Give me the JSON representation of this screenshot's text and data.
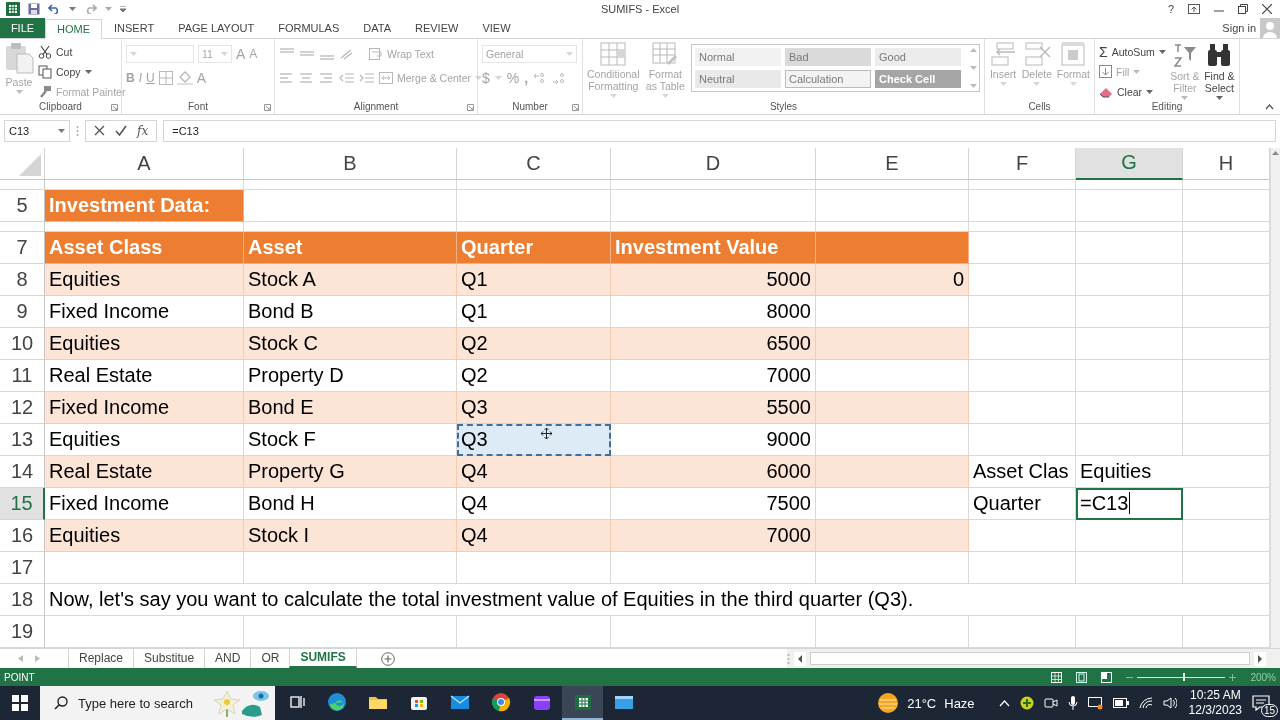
{
  "window": {
    "title": "SUMIFS - Excel",
    "help": "?"
  },
  "ribbon_tabs": [
    {
      "label": "FILE",
      "kind": "file",
      "selected": false
    },
    {
      "label": "HOME",
      "kind": "tab",
      "selected": true
    },
    {
      "label": "INSERT",
      "kind": "tab",
      "selected": false
    },
    {
      "label": "PAGE LAYOUT",
      "kind": "tab",
      "selected": false
    },
    {
      "label": "FORMULAS",
      "kind": "tab",
      "selected": false
    },
    {
      "label": "DATA",
      "kind": "tab",
      "selected": false
    },
    {
      "label": "REVIEW",
      "kind": "tab",
      "selected": false
    },
    {
      "label": "VIEW",
      "kind": "tab",
      "selected": false
    }
  ],
  "account": {
    "label": "Sign in"
  },
  "ribbon": {
    "clipboard": {
      "label": "Clipboard",
      "paste": {
        "label": "Paste",
        "disabled": true
      },
      "cut": {
        "label": "Cut",
        "disabled": false
      },
      "copy": {
        "label": "Copy",
        "disabled": false
      },
      "format_painter": {
        "label": "Format Painter",
        "disabled": true
      }
    },
    "font": {
      "label": "Font",
      "disabled": true,
      "size": "11",
      "grow": "A",
      "shrink": "A",
      "bold": "B",
      "italic": "I",
      "underline": "U",
      "font_color_label": "A"
    },
    "alignment": {
      "label": "Alignment",
      "disabled": true,
      "wrap_text": "Wrap Text",
      "merge_center": "Merge & Center"
    },
    "number": {
      "label": "Number",
      "disabled": true,
      "format": "General",
      "currency": "$",
      "percent": "%",
      "comma": ","
    },
    "styles": {
      "label": "Styles",
      "disabled": true,
      "conditional_formatting": "Conditional Formatting",
      "format_as_table": "Format as Table",
      "cell_styles": [
        {
          "label": "Normal",
          "color": "#f2f2f2"
        },
        {
          "label": "Bad",
          "color": "#dadada"
        },
        {
          "label": "Good",
          "color": "#ececec"
        },
        {
          "label": "Neutral",
          "color": "#e9e9e9"
        },
        {
          "label": "Calculation",
          "color": "#f3f3f3"
        },
        {
          "label": "Check Cell",
          "color": "#a5a5a5"
        }
      ]
    },
    "cells": {
      "label": "Cells",
      "disabled": true,
      "insert": "Insert",
      "delete": "Delete",
      "format": "Format"
    },
    "editing": {
      "label": "Editing",
      "autosum": {
        "symbol": "Σ",
        "label": "AutoSum",
        "disabled": false
      },
      "fill": {
        "label": "Fill",
        "disabled": true
      },
      "clear": {
        "label": "Clear",
        "disabled": false
      },
      "sort_filter": {
        "label": "Sort & Filter",
        "disabled": true
      },
      "find_select": {
        "label": "Find & Select",
        "disabled": false
      }
    }
  },
  "formula_bar": {
    "name_box": "C13",
    "function_label": "fx",
    "formula": "=C13"
  },
  "sheet": {
    "columns": [
      {
        "label": "A",
        "selected": false
      },
      {
        "label": "B",
        "selected": false
      },
      {
        "label": "C",
        "selected": false
      },
      {
        "label": "D",
        "selected": false
      },
      {
        "label": "E",
        "selected": false
      },
      {
        "label": "F",
        "selected": false
      },
      {
        "label": "G",
        "selected": true
      },
      {
        "label": "H",
        "selected": false
      }
    ],
    "rows": [
      {
        "short": true,
        "selected": false,
        "kind": "plain"
      },
      {
        "number": "5",
        "short": false,
        "selected": false,
        "kind": "title",
        "cells": [
          {
            "text": "Investment Data:"
          }
        ]
      },
      {
        "short": true,
        "selected": false,
        "kind": "plain"
      },
      {
        "number": "7",
        "short": false,
        "selected": false,
        "kind": "header",
        "cells": [
          {
            "text": "Asset Class"
          },
          {
            "text": "Asset"
          },
          {
            "text": "Quarter"
          },
          {
            "text": "Investment Value"
          }
        ]
      },
      {
        "number": "8",
        "short": false,
        "selected": false,
        "kind": "band",
        "cells": [
          {
            "text": "Equities"
          },
          {
            "text": "Stock A"
          },
          {
            "text": "Q1"
          },
          {
            "text": "5000",
            "kind": "number"
          },
          {
            "text": "0",
            "kind": "number"
          }
        ]
      },
      {
        "number": "9",
        "short": false,
        "selected": false,
        "kind": "plain",
        "cells": [
          {
            "text": "Fixed Income"
          },
          {
            "text": "Bond B"
          },
          {
            "text": "Q1"
          },
          {
            "text": "8000",
            "kind": "number"
          }
        ]
      },
      {
        "number": "10",
        "short": false,
        "selected": false,
        "kind": "band",
        "cells": [
          {
            "text": "Equities"
          },
          {
            "text": "Stock C"
          },
          {
            "text": "Q2"
          },
          {
            "text": "6500",
            "kind": "number"
          }
        ]
      },
      {
        "number": "11",
        "short": false,
        "selected": false,
        "kind": "plain",
        "cells": [
          {
            "text": "Real Estate"
          },
          {
            "text": "Property D"
          },
          {
            "text": "Q2"
          },
          {
            "text": "7000",
            "kind": "number"
          }
        ]
      },
      {
        "number": "12",
        "short": false,
        "selected": false,
        "kind": "band",
        "cells": [
          {
            "text": "Fixed Income"
          },
          {
            "text": "Bond E"
          },
          {
            "text": "Q3"
          },
          {
            "text": "5500",
            "kind": "number"
          }
        ]
      },
      {
        "number": "13",
        "short": false,
        "selected": false,
        "kind": "plain",
        "cells": [
          {
            "text": "Equities"
          },
          {
            "text": "Stock F"
          },
          {
            "text": "Q3",
            "referenced": true
          },
          {
            "text": "9000",
            "kind": "number"
          }
        ]
      },
      {
        "number": "14",
        "short": false,
        "selected": false,
        "kind": "band",
        "cells": [
          {
            "text": "Real Estate"
          },
          {
            "text": "Property G"
          },
          {
            "text": "Q4"
          },
          {
            "text": "6000",
            "kind": "number"
          },
          null,
          {
            "text": "Asset Clas"
          },
          {
            "text": "Equities"
          }
        ]
      },
      {
        "number": "15",
        "short": false,
        "selected": true,
        "kind": "plain",
        "cells": [
          {
            "text": "Fixed Income"
          },
          {
            "text": "Bond H"
          },
          {
            "text": "Q4"
          },
          {
            "text": "7500",
            "kind": "number"
          },
          null,
          {
            "text": "Quarter"
          },
          {
            "text": "=C13",
            "editing": true
          }
        ]
      },
      {
        "number": "16",
        "short": false,
        "selected": false,
        "kind": "band",
        "cells": [
          {
            "text": "Equities"
          },
          {
            "text": "Stock I"
          },
          {
            "text": "Q4"
          },
          {
            "text": "7000",
            "kind": "number"
          }
        ]
      },
      {
        "number": "17",
        "short": false,
        "selected": false,
        "kind": "plain"
      },
      {
        "number": "18",
        "short": false,
        "selected": false,
        "kind": "plain",
        "cells": [
          {
            "text": "Now, let's say you want to calculate the total investment value of Equities in the third quarter (Q3)."
          }
        ]
      },
      {
        "number": "19",
        "short": false,
        "selected": false,
        "kind": "plain"
      }
    ]
  },
  "sheet_tabs": [
    {
      "label": "Replace",
      "selected": false
    },
    {
      "label": "Substitue",
      "selected": false
    },
    {
      "label": "AND",
      "selected": false
    },
    {
      "label": "OR",
      "selected": false
    },
    {
      "label": "SUMIFS",
      "selected": true
    }
  ],
  "status_bar": {
    "mode": "POINT",
    "zoom": "200%",
    "slider": {
      "level": 0.53
    }
  },
  "taskbar": {
    "search_placeholder": "Type here to search",
    "apps": [
      {
        "kind": "task_view",
        "active": false
      },
      {
        "kind": "edge",
        "active": false
      },
      {
        "kind": "explorer",
        "active": false
      },
      {
        "kind": "store",
        "active": false
      },
      {
        "kind": "mail",
        "active": false
      },
      {
        "kind": "chrome",
        "active": false
      },
      {
        "kind": "clipchamp",
        "active": false
      },
      {
        "kind": "excel",
        "active": true
      },
      {
        "kind": "window",
        "active": false
      }
    ],
    "temperature": "21°C",
    "weather": "Haze",
    "time": "10:25 AM",
    "date": "12/3/2023",
    "notifications": "15"
  }
}
